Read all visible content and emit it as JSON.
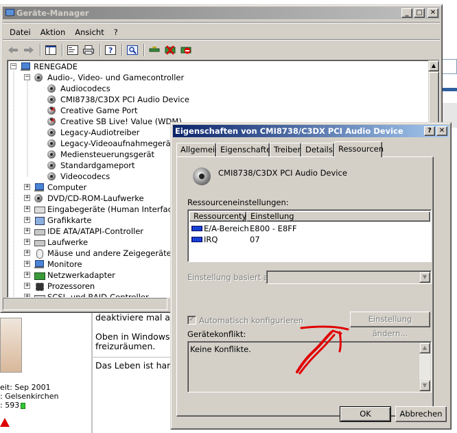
{
  "background_page": {
    "lines": [
      "deaktiviere mal a",
      "Oben in Windows",
      "freizuräumen.",
      "Das Leben ist har"
    ],
    "profile": {
      "joined": "eit: Sep 2001",
      "location": ": Gelsenkirchen",
      "posts": ": 593"
    }
  },
  "device_manager": {
    "title": "Geräte-Manager",
    "menu": [
      "Datei",
      "Aktion",
      "Ansicht",
      "?"
    ],
    "toolbar_icons": [
      "back-icon",
      "forward-icon",
      "console-tree-icon",
      "properties-icon",
      "print-icon",
      "help-icon",
      "scan-hardware-icon",
      "update-driver-icon",
      "uninstall-icon",
      "disable-icon"
    ],
    "root": "RENEGADE",
    "category_expanded": "Audio-, Video- und Gamecontroller",
    "children": [
      {
        "label": "Audiocodecs",
        "disabled": false
      },
      {
        "label": "CMI8738/C3DX PCI Audio Device",
        "disabled": false
      },
      {
        "label": "Creative Game Port",
        "disabled": true
      },
      {
        "label": "Creative SB Live! Value (WDM)",
        "disabled": true
      },
      {
        "label": "Legacy-Audiotreiber",
        "disabled": false
      },
      {
        "label": "Legacy-Videoaufnahmegerät",
        "disabled": false
      },
      {
        "label": "Mediensteuerungsgerät",
        "disabled": false
      },
      {
        "label": "Standardgameport",
        "disabled": false
      },
      {
        "label": "Videocodecs",
        "disabled": false
      }
    ],
    "categories": [
      {
        "label": "Computer",
        "icon": "computer-icon"
      },
      {
        "label": "DVD/CD-ROM-Laufwerke",
        "icon": "cd-drive-icon"
      },
      {
        "label": "Eingabegeräte (Human Interface Dev",
        "icon": "hid-icon"
      },
      {
        "label": "Grafikkarte",
        "icon": "display-adapter-icon"
      },
      {
        "label": "IDE ATA/ATAPI-Controller",
        "icon": "ide-controller-icon"
      },
      {
        "label": "Laufwerke",
        "icon": "disk-drive-icon"
      },
      {
        "label": "Mäuse und andere Zeigegeräte",
        "icon": "mouse-icon"
      },
      {
        "label": "Monitore",
        "icon": "monitor-icon"
      },
      {
        "label": "Netzwerkadapter",
        "icon": "network-adapter-icon"
      },
      {
        "label": "Prozessoren",
        "icon": "processor-icon"
      },
      {
        "label": "SCSI- und RAID-Controller",
        "icon": "scsi-controller-icon"
      }
    ]
  },
  "properties_dialog": {
    "title": "Eigenschaften von CMI8738/C3DX PCI Audio Device",
    "tabs": [
      "Allgemein",
      "Eigenschaften",
      "Treiber",
      "Details",
      "Ressourcen"
    ],
    "selected_tab": "Ressourcen",
    "device_name": "CMI8738/C3DX PCI Audio Device",
    "resources_label": "Ressourceneinstellungen:",
    "columns": [
      "Ressourcentyp",
      "Einstellung"
    ],
    "resources": [
      {
        "type": "E/A-Bereich",
        "setting": "E800 - E8FF"
      },
      {
        "type": "IRQ",
        "setting": "07"
      }
    ],
    "based_on_label": "Einstellung basiert auf:",
    "auto_config_label": "Automatisch konfigurieren",
    "auto_config_checked": true,
    "change_setting_button": "Einstellung ändern...",
    "conflict_label": "Gerätekonflikt:",
    "conflict_text": "Keine Konflikte.",
    "ok_button": "OK",
    "cancel_button": "Abbrechen"
  },
  "colors": {
    "active_title_start": "#0a246a",
    "active_title_end": "#a6caf0",
    "inactive_title_start": "#808080",
    "window_face": "#d4d0c8",
    "annotation_red": "#e00000"
  }
}
